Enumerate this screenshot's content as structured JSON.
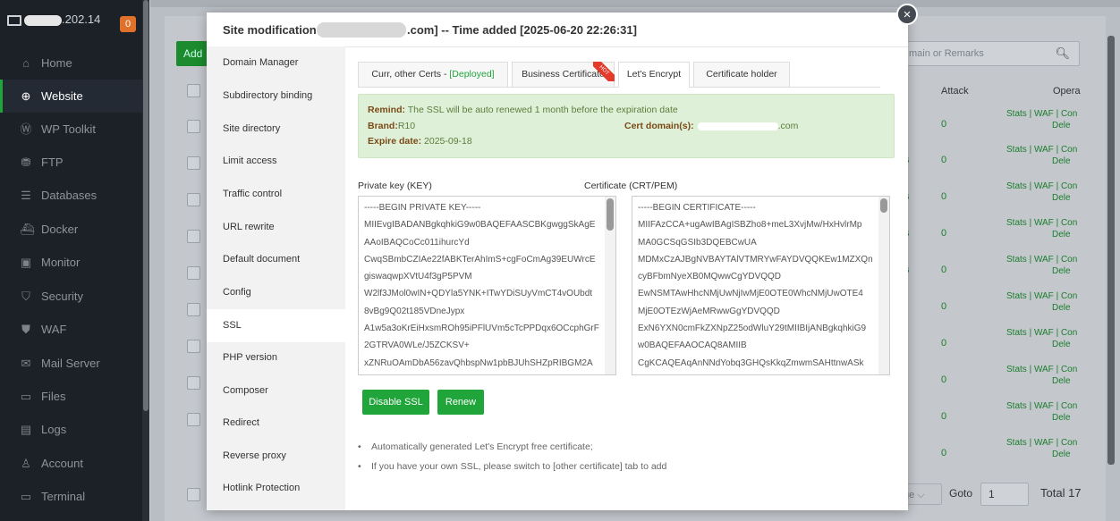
{
  "sidebar": {
    "server_ip": ".202.14",
    "badge": "0",
    "items": [
      {
        "label": "Home",
        "icon": "⌂"
      },
      {
        "label": "Website",
        "icon": "⊕"
      },
      {
        "label": "WP Toolkit",
        "icon": "Ⓦ"
      },
      {
        "label": "FTP",
        "icon": "⛃"
      },
      {
        "label": "Databases",
        "icon": "☰"
      },
      {
        "label": "Docker",
        "icon": "⛴"
      },
      {
        "label": "Monitor",
        "icon": "▣"
      },
      {
        "label": "Security",
        "icon": "⛉"
      },
      {
        "label": "WAF",
        "icon": "⛊"
      },
      {
        "label": "Mail Server",
        "icon": "✉"
      },
      {
        "label": "Files",
        "icon": "▭"
      },
      {
        "label": "Logs",
        "icon": "▤"
      },
      {
        "label": "Account",
        "icon": "♙"
      },
      {
        "label": "Terminal",
        "icon": "▭"
      }
    ]
  },
  "background": {
    "add_label": "Add",
    "search_placeholder": "main or Remarks",
    "col_attack": "Attack",
    "col_oper": "Opera",
    "row_value": "0",
    "row_links_1": "Stats | WAF | Con",
    "row_links_2": "Dele",
    "row_s": "s",
    "page_label": "ge",
    "goto_label": "Goto",
    "goto_value": "1",
    "total_label": "Total 17"
  },
  "modal": {
    "title_prefix": "Site modification [",
    "title_suffix": ".com] -- Time added [2025-06-20 22:26:31]",
    "close": "×",
    "menu": [
      "Domain Manager",
      "Subdirectory binding",
      "Site directory",
      "Limit access",
      "Traffic control",
      "URL rewrite",
      "Default document",
      "Config",
      "SSL",
      "PHP version",
      "Composer",
      "Redirect",
      "Reverse proxy",
      "Hotlink Protection"
    ],
    "tabs": {
      "t1_prefix": "Curr, other Certs - ",
      "t1_status": "[Deployed]",
      "t2": "Business Certificate",
      "t2_hot": "HOT",
      "t3": "Let's Encrypt",
      "t4": "Certificate holder"
    },
    "notice": {
      "remind_label": "Remind:",
      "remind_text": " The SSL will be auto renewed 1 month before the expiration date",
      "brand_label": "Brand:",
      "brand_value": "R10",
      "cert_label": "Cert domain(s):",
      "cert_suffix": ".com",
      "expire_label": "Expire date:",
      "expire_value": " 2025-09-18"
    },
    "key_label": "Private key (KEY)",
    "cert_label": "Certificate (CRT/PEM)",
    "key_lines": [
      "-----BEGIN PRIVATE KEY-----",
      "MIIEvgIBADANBgkqhkiG9w0BAQEFAASCBKgwggSkAgE",
      "AAoIBAQCoCc011ihurcYd",
      "CwqSBmbCZIAe22fABKTerAhImS+cgFoCmAg39EUWrcE",
      "giswaqwpXVtU4f3gP5PVM",
      "W2lf3JMol0wIN+QDYla5YNK+ITwYDiSUyVmCT4vOUbdt",
      "8vBg9Q02t185VDneJypx",
      "A1w5a3oKrEiHxsmROh95iPFlUVm5cTcPPDqx6OCcphGrF",
      "2GTRVA0WLe/J5ZCKSV+",
      "xZNRuOAmDbA56zavQhbspNw1pbBJUhSHZpRIBGM2A"
    ],
    "cert_lines": [
      "-----BEGIN CERTIFICATE-----",
      "MIIFAzCCA+ugAwIBAgISBZho8+meL3XvjMw/HxHvlrMp",
      "MA0GCSqGSIb3DQEBCwUA",
      "MDMxCzAJBgNVBAYTAlVTMRYwFAYDVQQKEw1MZXQn",
      "cyBFbmNyeXB0MQwwCgYDVQQD",
      "EwNSMTAwHhcNMjUwNjIwMjE0OTE0WhcNMjUwOTE4",
      "MjE0OTEzWjAeMRwwGgYDVQQD",
      "ExN6YXN0cmFkZXNpZ25odWluY29tMIIBIjANBgkqhkiG9",
      "w0BAQEFAAOCAQ8AMIIB",
      "CgKCAQEAqAnNNdYobq3GHQsKkqZmwmSAHttnwASk"
    ],
    "disable_btn": "Disable SSL",
    "renew_btn": "Renew",
    "tips": [
      "Automatically generated Let's Encrypt free certificate;",
      "If you have your own SSL, please switch to [other certificate] tab to add"
    ]
  }
}
